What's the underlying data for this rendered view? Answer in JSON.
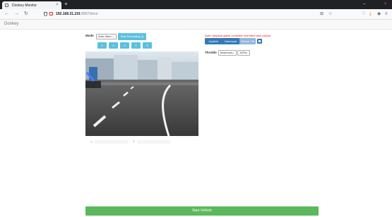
{
  "browser": {
    "tab_title": "Donkey Monitor",
    "tab_close": "×",
    "new_tab": "+",
    "url_host": "192.168.31.191",
    "url_path": ":8887/drive",
    "back": "←",
    "forward": "→",
    "reload": "↻",
    "minimize": "–",
    "close": "×",
    "grid_icon": "⊞",
    "star_icon": "☆",
    "pocket_icon": "♡",
    "download_icon": "⤓",
    "ext_icon": "◉",
    "menu_icon": "≡"
  },
  "app": {
    "brand": "Donkey"
  },
  "controls": {
    "mode_label": "Mode",
    "mode_value": "Auto Steer",
    "record_button": "Start Recording (r)",
    "number_buttons": [
      "1",
      "2",
      "3",
      "4",
      "5"
    ],
    "steering_label": "↔",
    "throttle_symbol": "↕"
  },
  "right": {
    "warning": "Note: physical game controller overrides web control.",
    "drive_buttons": [
      "Joystick",
      "Gamepad",
      "Device Tilt"
    ],
    "active_drive": "Device Tilt",
    "throttle_label": "Throttle",
    "throttle_mode": "Maximum",
    "throttle_pct": "100%"
  },
  "footer": {
    "start_button": "Start Vehicle"
  },
  "colors": {
    "info": "#5bc0de",
    "primary": "#337ab7",
    "success": "#5cb85c",
    "warning_text": "#ff0000"
  }
}
